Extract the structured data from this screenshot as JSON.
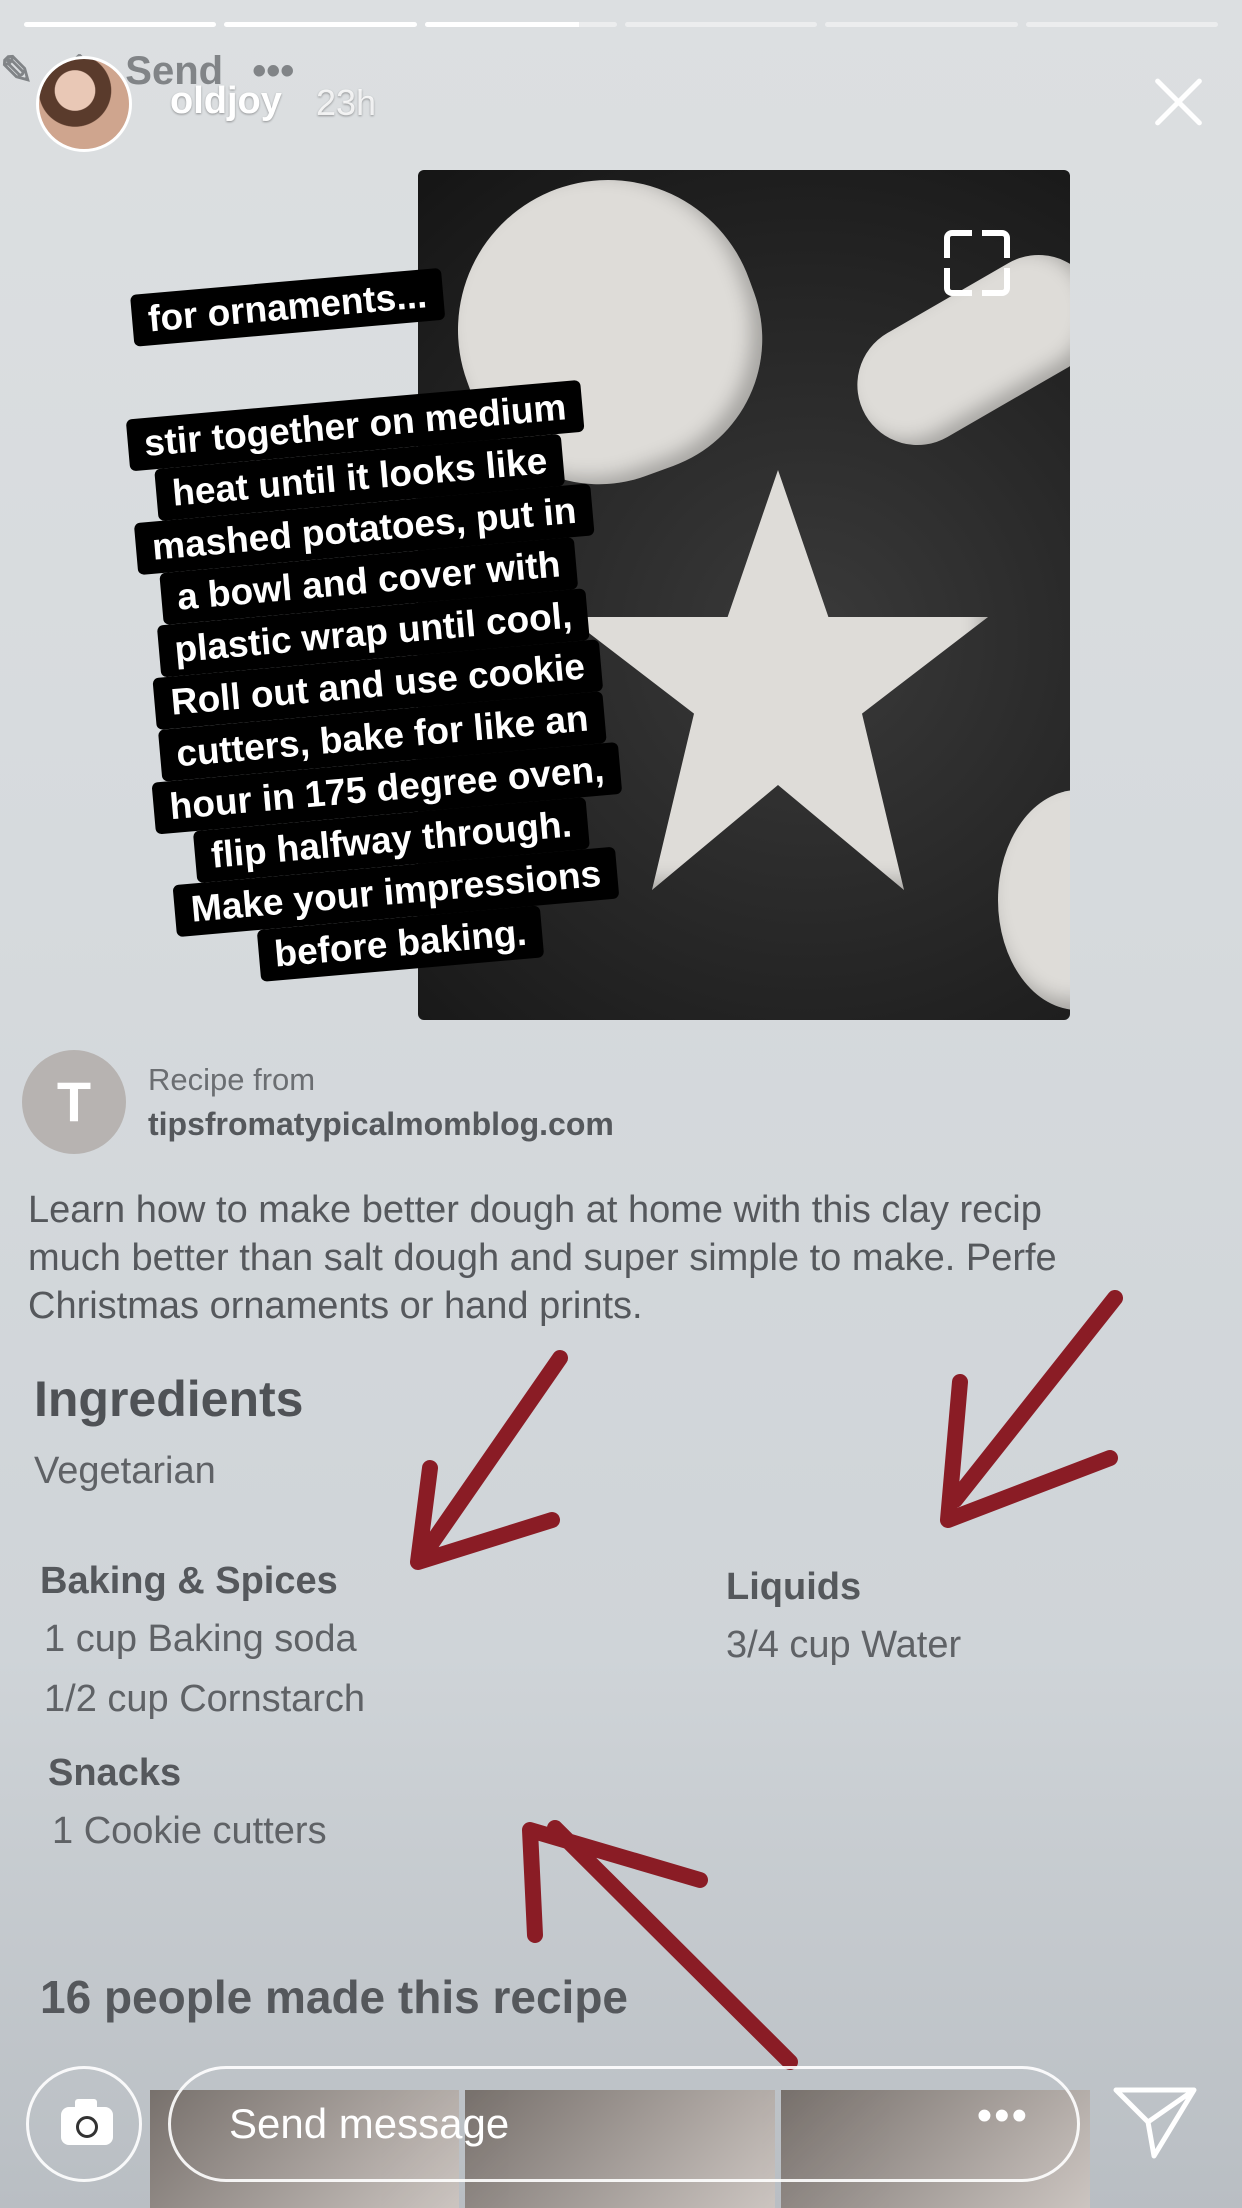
{
  "story": {
    "progress": [
      1,
      1,
      0.8,
      0,
      0,
      0
    ],
    "username": "oldjoy",
    "time": "23h"
  },
  "background_toolbar": {
    "send": "Send",
    "more": "•••"
  },
  "captions": {
    "title": "for ornaments...",
    "lines": [
      "stir together on medium",
      "heat until it looks like",
      "mashed potatoes, put in",
      "a bowl and cover with",
      "plastic wrap until cool,",
      "Roll out and use cookie",
      "cutters, bake for like an",
      "hour in 175 degree oven,",
      "flip halfway through.",
      "Make your impressions",
      "before baking."
    ]
  },
  "recipe": {
    "source_initial": "T",
    "source_prefix": "Recipe from",
    "source_site": "tipsfromatypicalmomblog.com",
    "description": "Learn how to make better dough at home with this clay recip\nmuch better than salt dough and super simple to make. Perfe\nChristmas ornaments or hand prints.",
    "ingredients_heading": "Ingredients",
    "diet": "Vegetarian",
    "groups": [
      {
        "title": "Baking & Spices",
        "items": [
          "1 cup Baking soda",
          "1/2 cup Cornstarch"
        ]
      },
      {
        "title": "Liquids",
        "items": [
          "3/4 cup Water"
        ]
      },
      {
        "title": "Snacks",
        "items": [
          "1 Cookie cutters"
        ]
      }
    ],
    "made_count": "16 people made this recipe"
  },
  "annotation_color": "#8a1c25",
  "bottom": {
    "message_placeholder": "Send message",
    "more": "•••"
  }
}
